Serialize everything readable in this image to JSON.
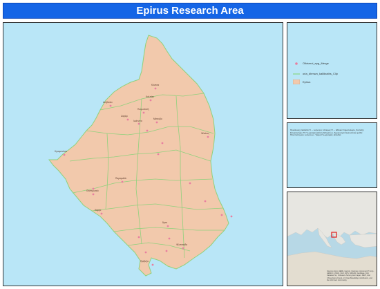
{
  "title": "Epirus Research Area",
  "colors": {
    "title_bg": "#1565e6",
    "sea": "#b9e6f7",
    "land": "#f2c9ac",
    "boundary": "#7fd36e",
    "point": "#e87fa0"
  },
  "legend": {
    "items": [
      {
        "label": "Oikismoi_epg_Merge",
        "symbol": "point"
      },
      {
        "label": "oria_dhmwn_kallikraths_Clip",
        "symbol": "line"
      },
      {
        "label": "Epirus",
        "symbol": "polygon"
      }
    ]
  },
  "credits": {
    "text": "Προέλευση: Ελλάδα Π. – Ιωάννινα, Ήπειρος Π. – Εθνικό Κτηματολόγιο. Σύνταξη: Επιμελητήριο Π. Γεωγραφική βάση δεδομένων. Δημιουργία: Ερευνητική ομάδα Πανεπιστημίου Ιωαννίνων. Τμήμα Γεωγραφίας, Ελλάδα."
  },
  "inset": {
    "attribution": "Sources: Esri, HERE, Garmin, Intermap, increment P Corp., GEBCO, USGS, FAO, NPS, NRCAN, GeoBase, IGN, Kadaster NL, Ordnance Survey, Esri Japan, METI, Esri China (Hong Kong), (c) OpenStreetMap contributors, and the GIS User Community"
  },
  "places": [
    {
      "name": "Κόνιτσα"
    },
    {
      "name": "Καλπάκι"
    },
    {
      "name": "Δελβινάκι"
    },
    {
      "name": "Πωγωνιανή"
    },
    {
      "name": "Ζαγόρι"
    },
    {
      "name": "Ιωάννινα"
    },
    {
      "name": "Μέτσοβο"
    },
    {
      "name": "Ηγουμενίτσα"
    },
    {
      "name": "Φιλιάτες"
    },
    {
      "name": "Παραμυθιά"
    },
    {
      "name": "Πάργα"
    },
    {
      "name": "Άρτα"
    },
    {
      "name": "Πρέβεζα"
    },
    {
      "name": "Φιλιππιάδα"
    },
    {
      "name": "Θεσπρωτικό"
    }
  ]
}
